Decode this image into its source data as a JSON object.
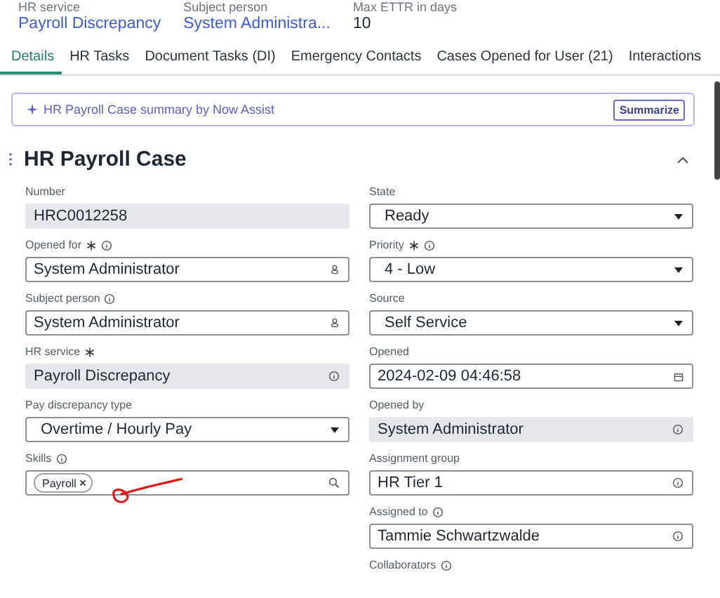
{
  "header_fields": [
    {
      "label": "HR service",
      "value": "Payroll Discrepancy",
      "link": true
    },
    {
      "label": "Subject person",
      "value": "System Administra...",
      "link": true
    },
    {
      "label": "Max ETTR in days",
      "value": "10",
      "link": false
    }
  ],
  "tabs": [
    {
      "label": "Details",
      "selected": true
    },
    {
      "label": "HR Tasks",
      "selected": false
    },
    {
      "label": "Document Tasks (DI)",
      "selected": false
    },
    {
      "label": "Emergency Contacts",
      "selected": false
    },
    {
      "label": "Cases Opened for User (21)",
      "selected": false
    },
    {
      "label": "Interactions",
      "selected": false
    }
  ],
  "assist_banner": {
    "text": "HR Payroll Case summary by Now Assist",
    "button": "Summarize"
  },
  "section": {
    "title": "HR Payroll Case",
    "expanded": true
  },
  "left_fields": [
    {
      "label": "Number",
      "kind": "readonly",
      "value": "HRC0012258",
      "required": false,
      "info": false
    },
    {
      "label": "Opened for",
      "kind": "reference",
      "value": "System Administrator",
      "required": true,
      "info": true
    },
    {
      "label": "Subject person",
      "kind": "reference",
      "value": "System Administrator",
      "required": false,
      "info": true
    },
    {
      "label": "HR service",
      "kind": "readonly_info",
      "value": "Payroll Discrepancy",
      "required": true,
      "info": false
    },
    {
      "label": "Pay discrepancy type",
      "kind": "select",
      "value": "Overtime / Hourly Pay",
      "required": false,
      "info": false
    },
    {
      "label": "Skills",
      "kind": "tags",
      "tags": [
        "Payroll"
      ],
      "required": false,
      "info": true
    }
  ],
  "right_fields": [
    {
      "label": "State",
      "kind": "select",
      "value": "Ready",
      "required": false,
      "info": false
    },
    {
      "label": "Priority",
      "kind": "select",
      "value": "4 - Low",
      "required": true,
      "info": true
    },
    {
      "label": "Source",
      "kind": "select",
      "value": "Self Service",
      "required": false,
      "info": false
    },
    {
      "label": "Opened",
      "kind": "date",
      "value": "2024-02-09 04:46:58",
      "required": false,
      "info": false
    },
    {
      "label": "Opened by",
      "kind": "readonly_info",
      "value": "System Administrator",
      "required": false,
      "info": false
    },
    {
      "label": "Assignment group",
      "kind": "info_field",
      "value": "HR Tier 1",
      "required": false,
      "info": false
    },
    {
      "label": "Assigned to",
      "kind": "info_field",
      "value": "Tammie Schwartzwalde",
      "required": false,
      "info": true
    },
    {
      "label": "Collaborators",
      "kind": "label_only",
      "required": false,
      "info": true
    }
  ]
}
